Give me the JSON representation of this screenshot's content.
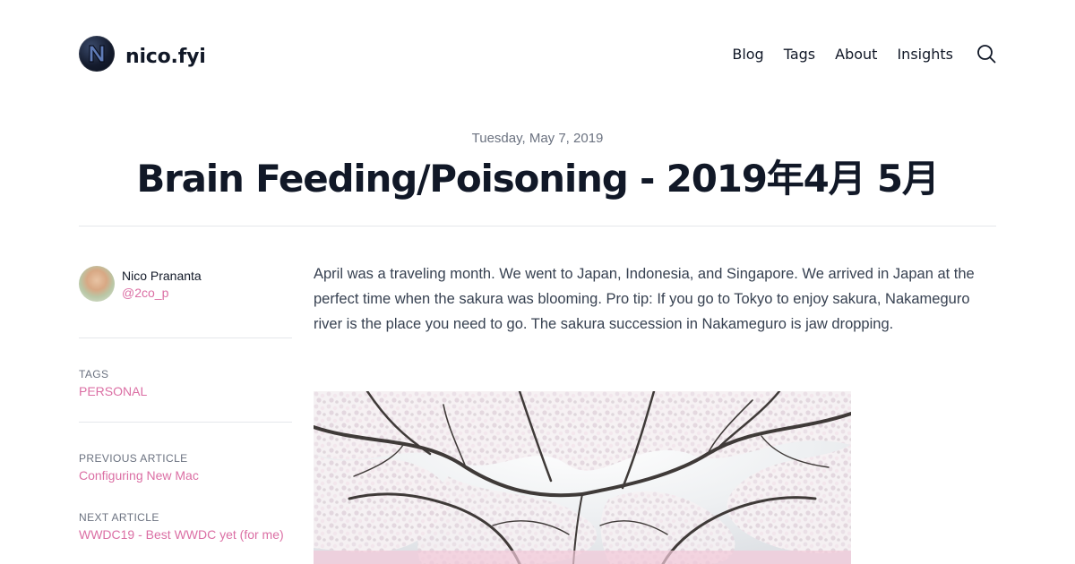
{
  "site": {
    "name": "nico.fyi",
    "logo_letter": "N"
  },
  "nav": {
    "items": [
      {
        "label": "Blog"
      },
      {
        "label": "Tags"
      },
      {
        "label": "About"
      },
      {
        "label": "Insights"
      }
    ],
    "search_icon": "search-icon"
  },
  "article": {
    "date": "Tuesday, May 7, 2019",
    "title": "Brain Feeding/Poisoning - 2019年4月 5月",
    "body": "April was a traveling month. We went to Japan, Indonesia, and Singapore. We arrived in Japan at the perfect time when the sakura was blooming. Pro tip: If you go to Tokyo to enjoy sakura, Nakameguro river is the place you need to go. The sakura succession in Nakameguro is jaw dropping."
  },
  "author": {
    "name": "Nico Prananta",
    "handle": "@2co_p"
  },
  "sidebar": {
    "tags_label": "TAGS",
    "tags": [
      "PERSONAL"
    ],
    "previous_label": "PREVIOUS ARTICLE",
    "previous_title": "Configuring New Mac",
    "next_label": "NEXT ARTICLE",
    "next_title": "WWDC19 - Best WWDC yet (for me)"
  },
  "colors": {
    "accent": "#db6fa4",
    "text": "#111827",
    "muted": "#6b7280",
    "divider": "#e5e7eb"
  }
}
